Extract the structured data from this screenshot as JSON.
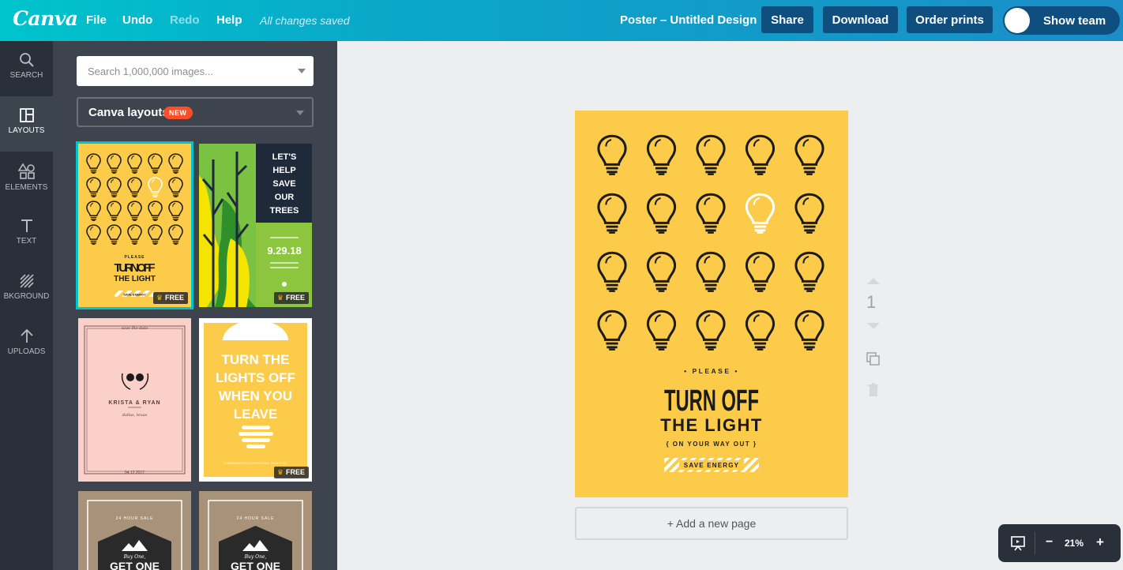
{
  "app": {
    "logo": "Canva"
  },
  "topbar": {
    "menu": [
      "File",
      "Undo",
      "Redo",
      "Help"
    ],
    "status": "All changes saved",
    "doc_title": "Poster – Untitled Design",
    "share": "Share",
    "download": "Download",
    "order_prints": "Order prints",
    "show_team": "Show team"
  },
  "sidebar": {
    "items": [
      {
        "label": "SEARCH",
        "icon": "search-icon"
      },
      {
        "label": "LAYOUTS",
        "icon": "layouts-icon",
        "active": true
      },
      {
        "label": "ELEMENTS",
        "icon": "elements-icon"
      },
      {
        "label": "TEXT",
        "icon": "text-icon"
      },
      {
        "label": "BKGROUND",
        "icon": "background-icon"
      },
      {
        "label": "UPLOADS",
        "icon": "upload-icon"
      }
    ]
  },
  "panel": {
    "search_placeholder": "Search 1,000,000 images...",
    "dropdown_label": "Canva layouts",
    "dropdown_badge": "NEW",
    "free_label": "FREE",
    "templates": {
      "t1": {
        "please": "PLEASE",
        "line1": "TURN OFF",
        "line2": "THE LIGHT",
        "save": "SAVE ENERGY"
      },
      "t2": {
        "lines": [
          "LET'S",
          "HELP",
          "SAVE",
          "OUR",
          "TREES"
        ],
        "date": "9.29.18"
      },
      "t3": {
        "top": "save the date",
        "names": "KRISTA & RYAN",
        "place": "dallas, texas",
        "date": "04.12.2017"
      },
      "t4": {
        "lines": [
          "TURN THE",
          "LIGHTS OFF",
          "WHEN YOU",
          "LEAVE"
        ],
        "footer": "CONSERVATION IS CONTAGIOUS. PASS IT ON."
      },
      "t5": {
        "top": "24 HOUR SALE",
        "mid": "Buy One,",
        "big": "GET ONE"
      },
      "t6": {
        "top": "24 HOUR SALE",
        "mid": "Buy One,",
        "big": "GET ONE"
      }
    }
  },
  "canvas": {
    "poster": {
      "please": "• PLEASE •",
      "line1": "TURN OFF",
      "line2": "THE LIGHT",
      "sub": "{ ON YOUR WAY OUT }",
      "save": "SAVE ENERGY",
      "background": "#fdcb4a"
    },
    "page_number": "1",
    "add_page": "+ Add a new page"
  },
  "zoom": {
    "minus": "−",
    "level": "21%",
    "plus": "+"
  },
  "colors": {
    "accent": "#00c4cc",
    "button": "#0e4f80",
    "sidebar": "#293039",
    "panel": "#3d444d",
    "badge": "#ff4e27"
  }
}
